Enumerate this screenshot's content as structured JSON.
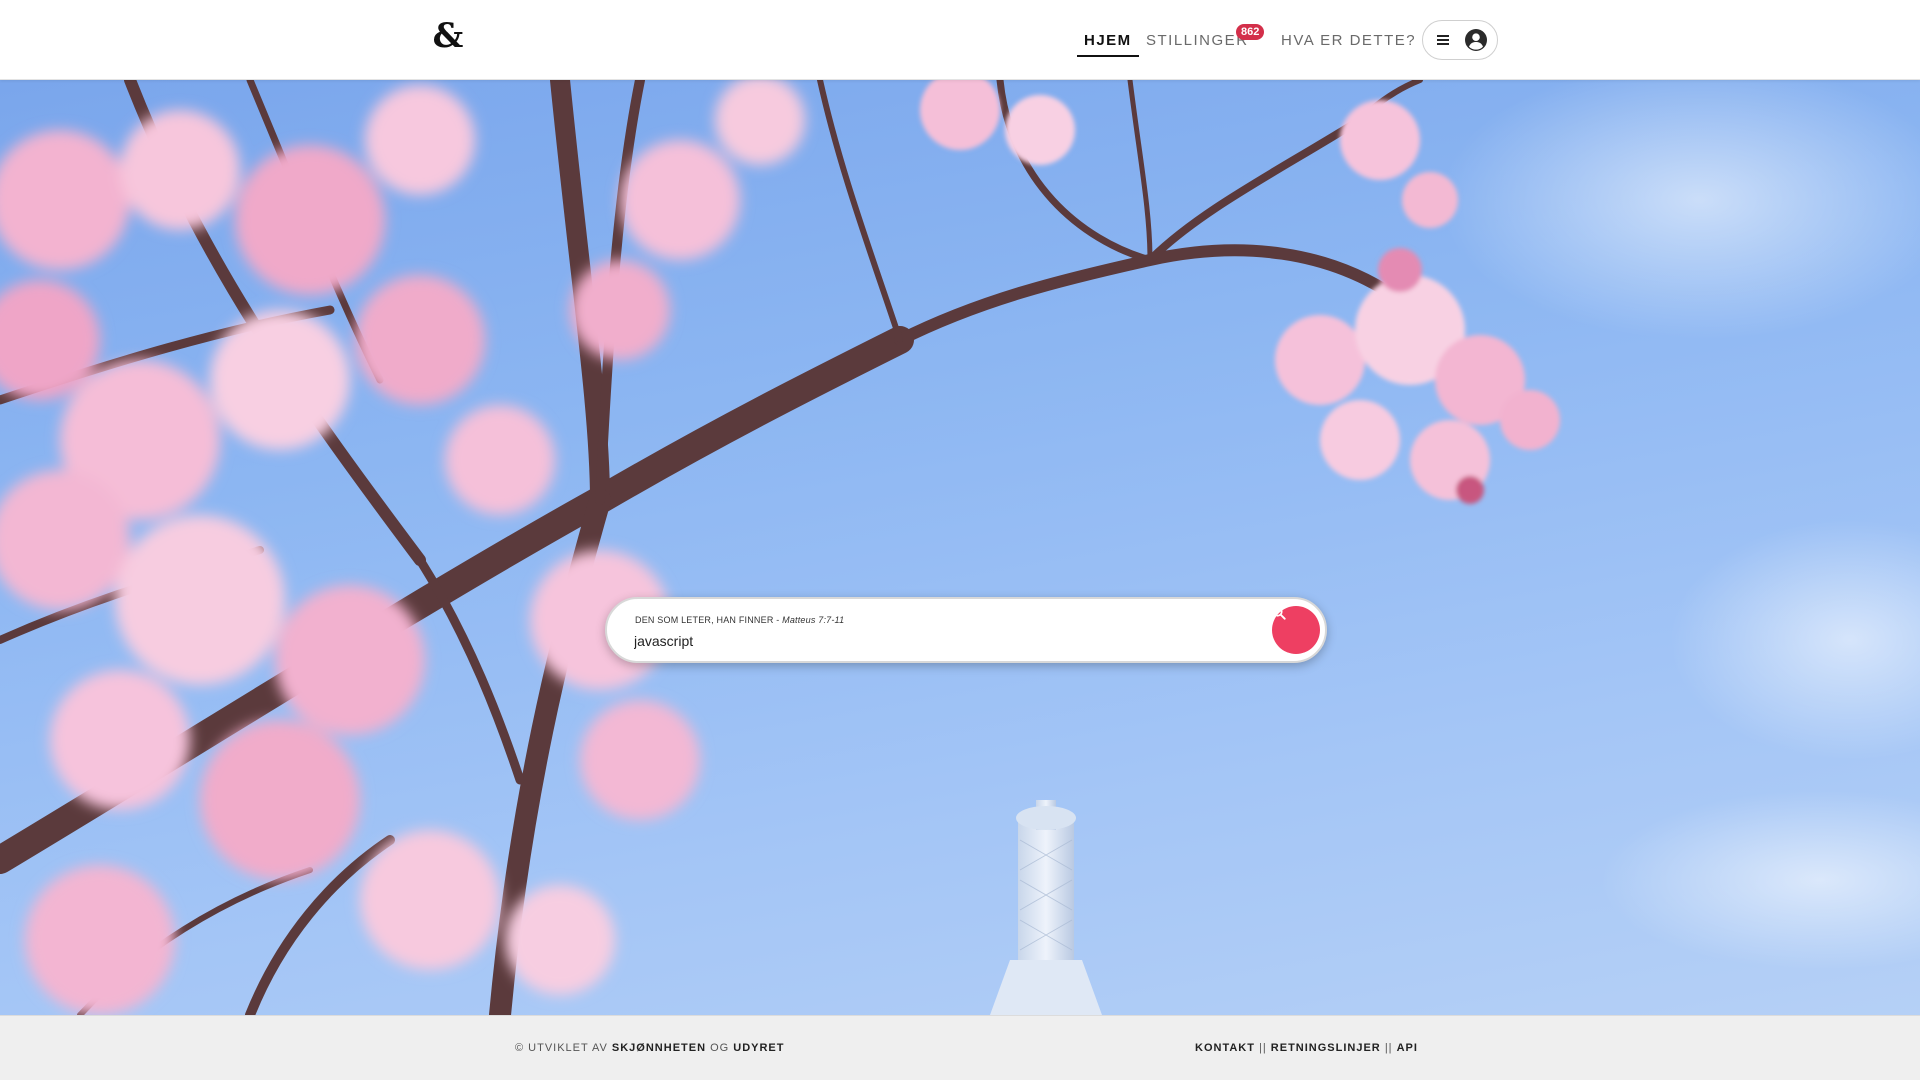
{
  "header": {
    "logo": "&",
    "nav": {
      "home": "HJEM",
      "jobs": "STILLINGER",
      "jobs_badge": "862",
      "about": "HVA ER DETTE?"
    },
    "menu_icon": "hamburger-icon",
    "account_icon": "user-circle-icon"
  },
  "search": {
    "label": "DEN SOM LETER, HAN FINNER - ",
    "label_reference": "Matteus 7:7-11",
    "value": "javascript",
    "button_icon": "search-icon",
    "button_color": "#ee3f62"
  },
  "footer": {
    "credit_prefix": "© UTVIKLET AV ",
    "credit_name1": "SKJØNNHETEN",
    "credit_and": " OG ",
    "credit_name2": "UDYRET",
    "links": [
      "KONTAKT",
      "RETNINGSLINJER",
      "API"
    ],
    "separator": " || "
  },
  "colors": {
    "accent": "#ee3f62",
    "badge": "#d32f4a",
    "sky": "#8cb6f2",
    "blossom": "#f3b6d3"
  }
}
